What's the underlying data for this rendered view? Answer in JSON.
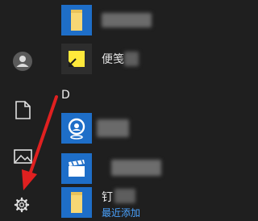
{
  "section_letter": "D",
  "apps": [
    {
      "name": "",
      "icon": "folder-icon"
    },
    {
      "name": "便笺",
      "icon": "sticky-notes-icon"
    },
    {
      "name": "",
      "icon": "maps-icon"
    },
    {
      "name": "",
      "icon": "video-editor-icon"
    },
    {
      "name": "钉",
      "icon": "folder-icon"
    }
  ],
  "recently_added_label": "最近添加",
  "rail": {
    "items": [
      "account-icon",
      "documents-icon",
      "pictures-icon",
      "settings-icon"
    ]
  },
  "colors": {
    "tile_blue": "#1e6ec8",
    "background": "#1f1f1f",
    "annotation_red": "#e02020",
    "link_blue": "#4aa3ff"
  }
}
